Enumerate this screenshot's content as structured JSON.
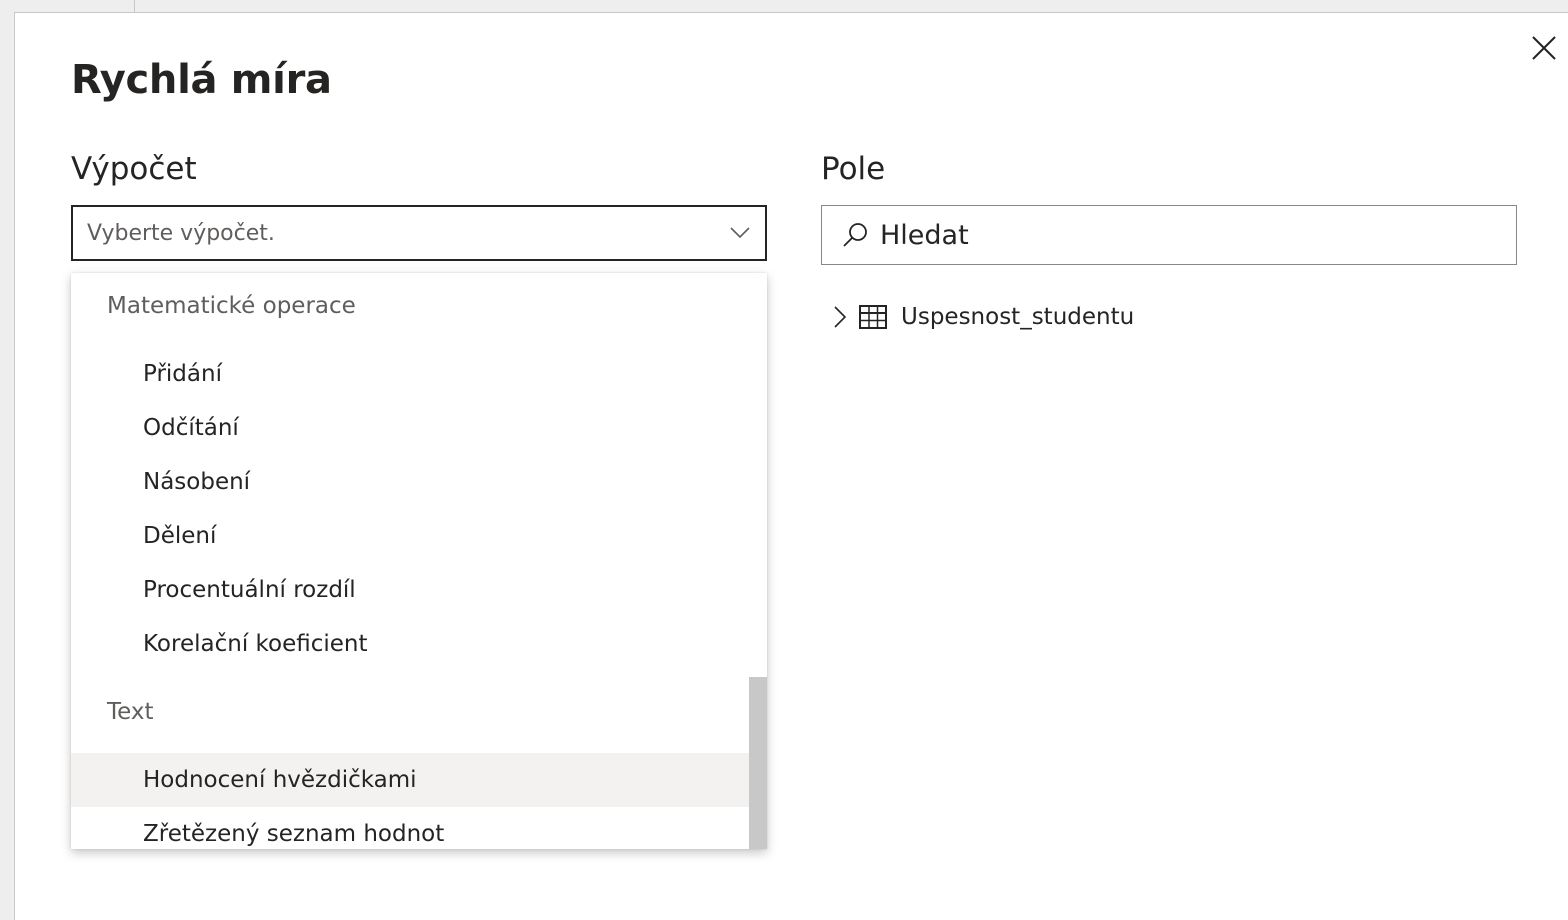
{
  "dialog": {
    "title": "Rychlá míra",
    "close_icon": "close-icon"
  },
  "calculation": {
    "label": "Výpočet",
    "select_placeholder": "Vyberte výpočet.",
    "chevron_icon": "chevron-down-icon",
    "groups": [
      {
        "header": "Matematické operace",
        "items": [
          {
            "label": "Přidání"
          },
          {
            "label": "Odčítání"
          },
          {
            "label": "Násobení"
          },
          {
            "label": "Dělení"
          },
          {
            "label": "Procentuální rozdíl"
          },
          {
            "label": "Korelační koeficient"
          }
        ]
      },
      {
        "header": "Text",
        "items": [
          {
            "label": "Hodnocení hvězdičkami",
            "hovered": true
          },
          {
            "label": "Zřetězený seznam hodnot"
          }
        ]
      }
    ]
  },
  "fields": {
    "label": "Pole",
    "search_placeholder": "Hledat",
    "search_icon": "search-icon",
    "tree": [
      {
        "label": "Uspesnost_studentu",
        "expand_icon": "chevron-right-icon",
        "type_icon": "table-icon"
      }
    ]
  },
  "colors": {
    "text": "#252423",
    "muted": "#605e5c",
    "hover": "#f3f2f1",
    "scrollbar": "#c8c8c8"
  }
}
